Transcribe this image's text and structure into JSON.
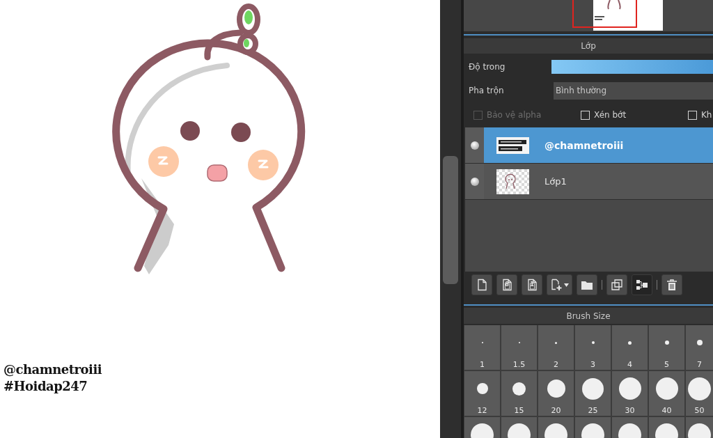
{
  "canvas": {
    "signature_lines": [
      "@chamnetroiii",
      "#Hoidap247"
    ]
  },
  "layer_panel": {
    "title": "Lớp",
    "opacity": {
      "label": "Độ trong",
      "level": 1
    },
    "blend": {
      "label": "Pha trộn",
      "value": "Bình thường"
    },
    "options": [
      {
        "label": "Bảo vệ alpha",
        "checked": false,
        "disabled": true
      },
      {
        "label": "Xén bớt",
        "checked": false,
        "disabled": false
      },
      {
        "label": "Kh",
        "checked": false,
        "disabled": false
      }
    ],
    "layers": [
      {
        "kind": "text",
        "name": "@chamnetroiii",
        "selected": true
      },
      {
        "kind": "raster",
        "name": "Lớp1",
        "selected": false
      }
    ],
    "toolbar_groups": [
      {
        "buttons": [
          {
            "kind": "page",
            "active": false
          },
          {
            "kind": "page-glyph",
            "glyph": "8",
            "active": false
          },
          {
            "kind": "page-glyph",
            "glyph": "1",
            "active": false
          },
          {
            "kind": "page-add-menu",
            "active": false
          },
          {
            "kind": "folder",
            "active": false
          }
        ]
      },
      {
        "buttons": [
          {
            "kind": "duplicate",
            "active": false
          },
          {
            "kind": "merge",
            "active": true
          }
        ]
      },
      {
        "buttons": [
          {
            "kind": "trash",
            "active": false
          }
        ]
      }
    ]
  },
  "brush_size": {
    "title": "Brush Size",
    "presets": [
      {
        "label": "1",
        "selected": false
      },
      {
        "label": "1.5",
        "selected": false
      },
      {
        "label": "2",
        "selected": false
      },
      {
        "label": "3",
        "selected": false
      },
      {
        "label": "4",
        "selected": false
      },
      {
        "label": "5",
        "selected": false
      },
      {
        "label": "7",
        "selected": false
      },
      {
        "label": "12",
        "selected": false
      },
      {
        "label": "15",
        "selected": false
      },
      {
        "label": "20",
        "selected": false
      },
      {
        "label": "25",
        "selected": false
      },
      {
        "label": "30",
        "selected": false
      },
      {
        "label": "40",
        "selected": false
      },
      {
        "label": "50",
        "selected": false
      },
      {
        "selected": false
      },
      {
        "selected": false
      },
      {
        "selected": false
      },
      {
        "selected": false
      },
      {
        "selected": false
      },
      {
        "selected": false
      },
      {
        "selected": false
      }
    ]
  }
}
